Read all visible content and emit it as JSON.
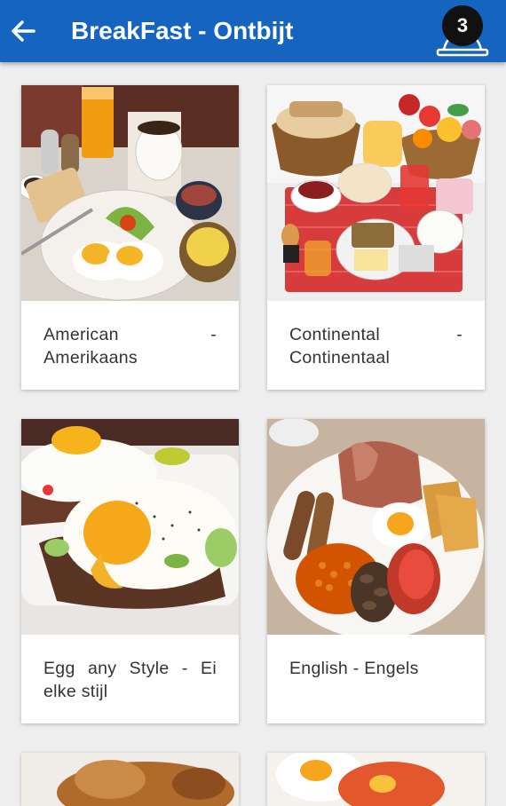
{
  "appbar": {
    "title": "BreakFast - Ontbijt",
    "back_icon": "arrow-back-icon",
    "cart_icon": "tray-icon",
    "cart_count": "3",
    "background_color": "#1565c0"
  },
  "items": [
    {
      "label": "American - Amerikaans",
      "image": "american-breakfast"
    },
    {
      "label": "Continental - Continentaal",
      "image": "continental-breakfast"
    },
    {
      "label": "Egg any Style - Ei elke stijl",
      "image": "egg-any-style"
    },
    {
      "label": "English - Engels",
      "image": "english-breakfast"
    }
  ]
}
